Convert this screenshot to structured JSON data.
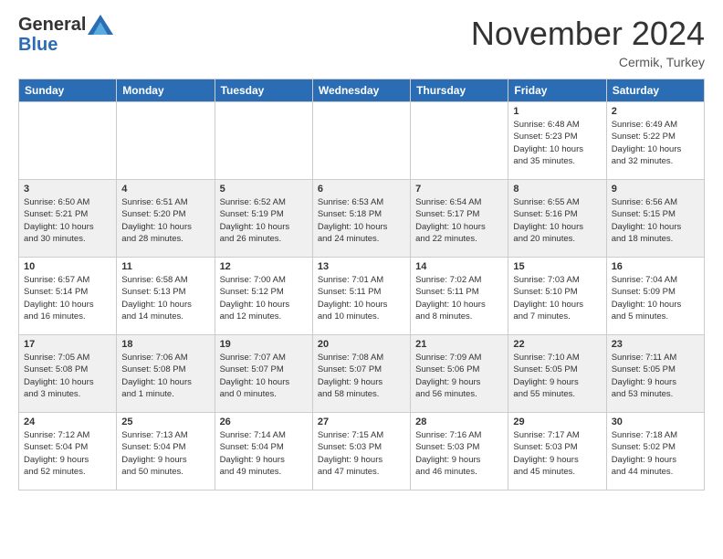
{
  "header": {
    "logo_general": "General",
    "logo_blue": "Blue",
    "month_year": "November 2024",
    "location": "Cermik, Turkey"
  },
  "days_of_week": [
    "Sunday",
    "Monday",
    "Tuesday",
    "Wednesday",
    "Thursday",
    "Friday",
    "Saturday"
  ],
  "weeks": [
    [
      {
        "day": "",
        "info": ""
      },
      {
        "day": "",
        "info": ""
      },
      {
        "day": "",
        "info": ""
      },
      {
        "day": "",
        "info": ""
      },
      {
        "day": "",
        "info": ""
      },
      {
        "day": "1",
        "info": "Sunrise: 6:48 AM\nSunset: 5:23 PM\nDaylight: 10 hours\nand 35 minutes."
      },
      {
        "day": "2",
        "info": "Sunrise: 6:49 AM\nSunset: 5:22 PM\nDaylight: 10 hours\nand 32 minutes."
      }
    ],
    [
      {
        "day": "3",
        "info": "Sunrise: 6:50 AM\nSunset: 5:21 PM\nDaylight: 10 hours\nand 30 minutes."
      },
      {
        "day": "4",
        "info": "Sunrise: 6:51 AM\nSunset: 5:20 PM\nDaylight: 10 hours\nand 28 minutes."
      },
      {
        "day": "5",
        "info": "Sunrise: 6:52 AM\nSunset: 5:19 PM\nDaylight: 10 hours\nand 26 minutes."
      },
      {
        "day": "6",
        "info": "Sunrise: 6:53 AM\nSunset: 5:18 PM\nDaylight: 10 hours\nand 24 minutes."
      },
      {
        "day": "7",
        "info": "Sunrise: 6:54 AM\nSunset: 5:17 PM\nDaylight: 10 hours\nand 22 minutes."
      },
      {
        "day": "8",
        "info": "Sunrise: 6:55 AM\nSunset: 5:16 PM\nDaylight: 10 hours\nand 20 minutes."
      },
      {
        "day": "9",
        "info": "Sunrise: 6:56 AM\nSunset: 5:15 PM\nDaylight: 10 hours\nand 18 minutes."
      }
    ],
    [
      {
        "day": "10",
        "info": "Sunrise: 6:57 AM\nSunset: 5:14 PM\nDaylight: 10 hours\nand 16 minutes."
      },
      {
        "day": "11",
        "info": "Sunrise: 6:58 AM\nSunset: 5:13 PM\nDaylight: 10 hours\nand 14 minutes."
      },
      {
        "day": "12",
        "info": "Sunrise: 7:00 AM\nSunset: 5:12 PM\nDaylight: 10 hours\nand 12 minutes."
      },
      {
        "day": "13",
        "info": "Sunrise: 7:01 AM\nSunset: 5:11 PM\nDaylight: 10 hours\nand 10 minutes."
      },
      {
        "day": "14",
        "info": "Sunrise: 7:02 AM\nSunset: 5:11 PM\nDaylight: 10 hours\nand 8 minutes."
      },
      {
        "day": "15",
        "info": "Sunrise: 7:03 AM\nSunset: 5:10 PM\nDaylight: 10 hours\nand 7 minutes."
      },
      {
        "day": "16",
        "info": "Sunrise: 7:04 AM\nSunset: 5:09 PM\nDaylight: 10 hours\nand 5 minutes."
      }
    ],
    [
      {
        "day": "17",
        "info": "Sunrise: 7:05 AM\nSunset: 5:08 PM\nDaylight: 10 hours\nand 3 minutes."
      },
      {
        "day": "18",
        "info": "Sunrise: 7:06 AM\nSunset: 5:08 PM\nDaylight: 10 hours\nand 1 minute."
      },
      {
        "day": "19",
        "info": "Sunrise: 7:07 AM\nSunset: 5:07 PM\nDaylight: 10 hours\nand 0 minutes."
      },
      {
        "day": "20",
        "info": "Sunrise: 7:08 AM\nSunset: 5:07 PM\nDaylight: 9 hours\nand 58 minutes."
      },
      {
        "day": "21",
        "info": "Sunrise: 7:09 AM\nSunset: 5:06 PM\nDaylight: 9 hours\nand 56 minutes."
      },
      {
        "day": "22",
        "info": "Sunrise: 7:10 AM\nSunset: 5:05 PM\nDaylight: 9 hours\nand 55 minutes."
      },
      {
        "day": "23",
        "info": "Sunrise: 7:11 AM\nSunset: 5:05 PM\nDaylight: 9 hours\nand 53 minutes."
      }
    ],
    [
      {
        "day": "24",
        "info": "Sunrise: 7:12 AM\nSunset: 5:04 PM\nDaylight: 9 hours\nand 52 minutes."
      },
      {
        "day": "25",
        "info": "Sunrise: 7:13 AM\nSunset: 5:04 PM\nDaylight: 9 hours\nand 50 minutes."
      },
      {
        "day": "26",
        "info": "Sunrise: 7:14 AM\nSunset: 5:04 PM\nDaylight: 9 hours\nand 49 minutes."
      },
      {
        "day": "27",
        "info": "Sunrise: 7:15 AM\nSunset: 5:03 PM\nDaylight: 9 hours\nand 47 minutes."
      },
      {
        "day": "28",
        "info": "Sunrise: 7:16 AM\nSunset: 5:03 PM\nDaylight: 9 hours\nand 46 minutes."
      },
      {
        "day": "29",
        "info": "Sunrise: 7:17 AM\nSunset: 5:03 PM\nDaylight: 9 hours\nand 45 minutes."
      },
      {
        "day": "30",
        "info": "Sunrise: 7:18 AM\nSunset: 5:02 PM\nDaylight: 9 hours\nand 44 minutes."
      }
    ]
  ]
}
